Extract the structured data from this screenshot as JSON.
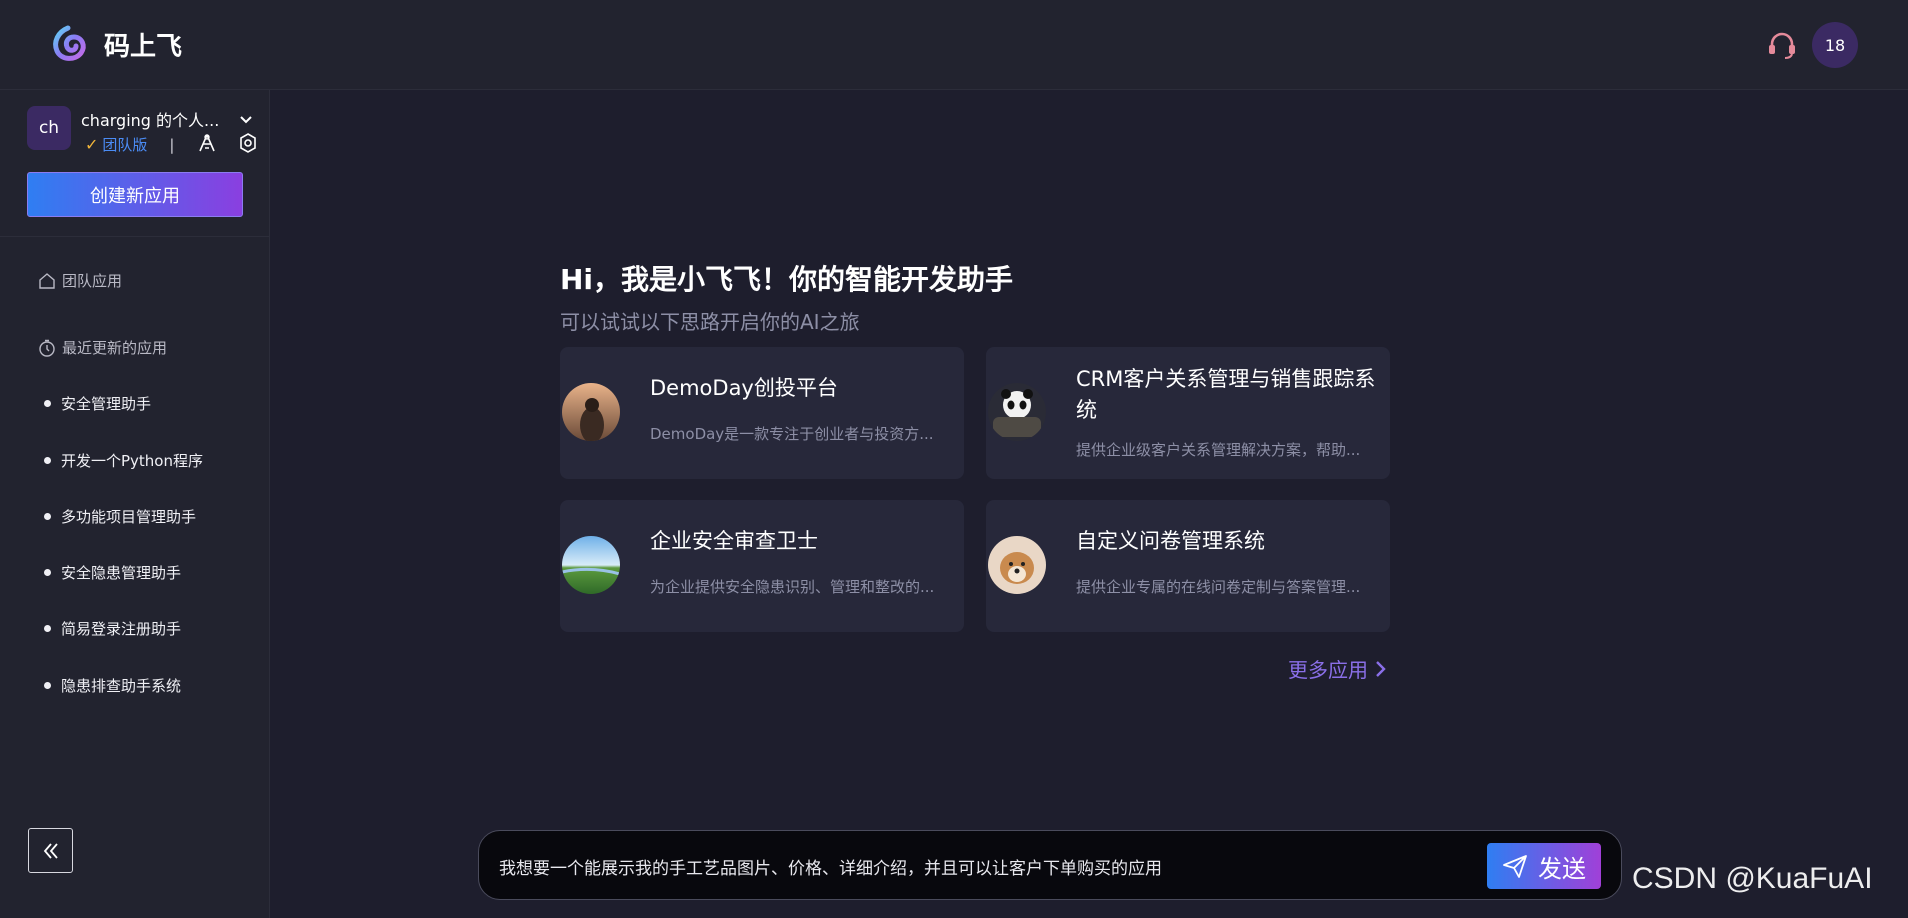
{
  "header": {
    "brand": "码上飞",
    "notification_count": "18"
  },
  "sidebar": {
    "avatar_initials": "ch",
    "workspace_name": "charging 的个人...",
    "plan_label": "团队版",
    "plan_separator": "|",
    "create_button": "创建新应用",
    "team_apps": "团队应用",
    "recent_apps_title": "最近更新的应用",
    "recent_apps": [
      "安全管理助手",
      "开发一个Python程序",
      "多功能项目管理助手",
      "安全隐患管理助手",
      "简易登录注册助手",
      "隐患排查助手系统"
    ]
  },
  "main": {
    "greeting": "Hi，我是小飞飞！你的智能开发助手",
    "subtitle": "可以试试以下思路开启你的AI之旅",
    "cards": [
      {
        "title": "DemoDay创投平台",
        "desc": "DemoDay是一款专注于创业者与投资方..."
      },
      {
        "title": "CRM客户关系管理与销售跟踪系统",
        "desc": "提供企业级客户关系管理解决方案，帮助..."
      },
      {
        "title": "企业安全审查卫士",
        "desc": "为企业提供安全隐患识别、管理和整改的..."
      },
      {
        "title": "自定义问卷管理系统",
        "desc": "提供企业专属的在线问卷定制与答案管理..."
      }
    ],
    "more_link": "更多应用"
  },
  "chat": {
    "input_value": "我想要一个能展示我的手工艺品图片、价格、详细介绍，并且可以让客户下单购买的应用",
    "send_label": "发送"
  },
  "watermark": "CSDN @KuaFuAI",
  "colors": {
    "accent_blue": "#2f7ef2",
    "accent_purple": "#8a3fe0",
    "background": "#1e1e2d"
  }
}
